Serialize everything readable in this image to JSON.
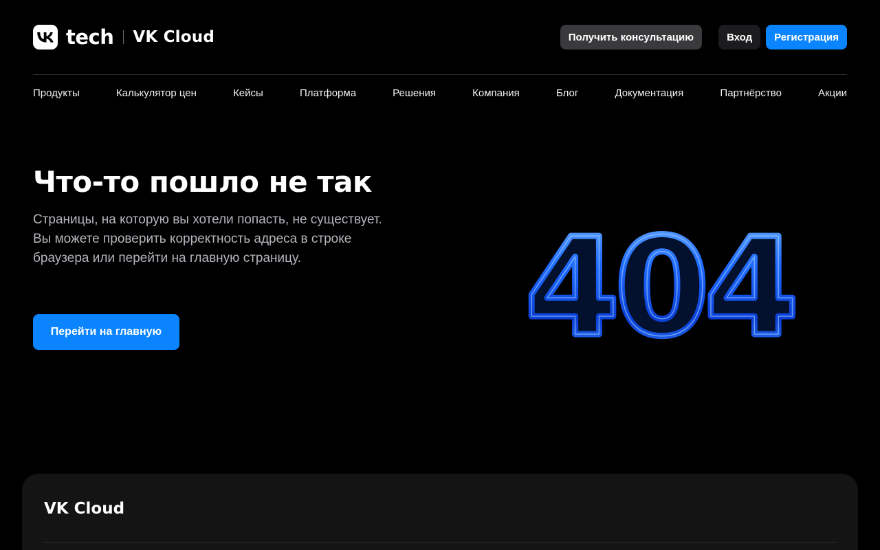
{
  "header": {
    "logo_icon": "vk-logo-icon",
    "brand_primary": "tech",
    "brand_secondary": "VK Cloud",
    "consult_label": "Получить консультацию",
    "login_label": "Вход",
    "register_label": "Регистрация"
  },
  "nav": {
    "items": [
      {
        "label": "Продукты"
      },
      {
        "label": "Калькулятор цен"
      },
      {
        "label": "Кейсы"
      },
      {
        "label": "Платформа"
      },
      {
        "label": "Решения"
      },
      {
        "label": "Компания"
      },
      {
        "label": "Блог"
      },
      {
        "label": "Документация"
      },
      {
        "label": "Партнёрство"
      },
      {
        "label": "Акции"
      }
    ]
  },
  "hero": {
    "title": "Что-то пошло не так",
    "description": "Страницы, на которую вы хотели попасть, не существует. Вы можете проверить корректность адреса в строке браузера или перейти на главную страницу.",
    "home_button_label": "Перейти на главную",
    "error_code": "404"
  },
  "footer": {
    "brand": "VK Cloud"
  },
  "colors": {
    "accent": "#0a84ff",
    "background": "#000000",
    "footer_bg": "#141414",
    "muted_text": "#b4b6bc"
  }
}
